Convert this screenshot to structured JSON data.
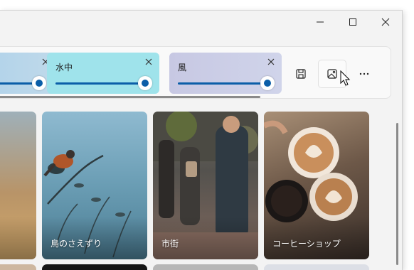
{
  "window": {
    "caption": {
      "minimize": "minimize-icon",
      "maximize": "maximize-icon",
      "close": "close-icon"
    }
  },
  "mixer": {
    "sounds": [
      {
        "label": "",
        "level": 0.95,
        "color": "#b4d4ea"
      },
      {
        "label": "水中",
        "level": 0.95,
        "color": "#9fe3eb"
      },
      {
        "label": "風",
        "level": 0.95,
        "color": "#c9cbe5"
      }
    ],
    "toolbar": {
      "save_icon": "save-icon",
      "image_icon": "image-icon",
      "more_icon": "more-icon"
    },
    "accent": "#0b5ea8"
  },
  "gallery": {
    "tiles": [
      {
        "label": ""
      },
      {
        "label": "鳥のさえずり"
      },
      {
        "label": "市街"
      },
      {
        "label": "コーヒーショップ"
      }
    ]
  }
}
